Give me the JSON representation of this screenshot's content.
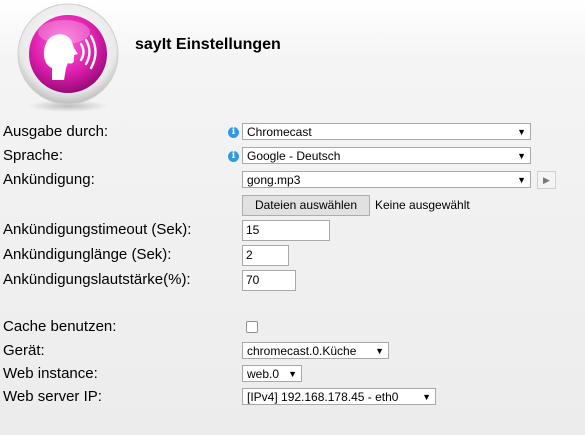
{
  "header": {
    "title": "sayIt Einstellungen",
    "logo_icon": "speaking-head-icon",
    "logo_color": "#e020b0"
  },
  "info_icon_color": "#3399e0",
  "fields": {
    "output": {
      "label": "Ausgabe durch:",
      "value": "Chromecast"
    },
    "language": {
      "label": "Sprache:",
      "value": "Google - Deutsch"
    },
    "announce": {
      "label": "Ankündigung:",
      "value": "gong.mp3",
      "play_icon": "play-icon"
    },
    "file": {
      "button": "Dateien auswählen",
      "status": "Keine ausgewählt"
    },
    "timeout": {
      "label": "Ankündigungstimeout (Sek):",
      "value": "15"
    },
    "length": {
      "label": "Ankündigunglänge (Sek):",
      "value": "2"
    },
    "volume": {
      "label": "Ankündigungslautstärke(%):",
      "value": "70"
    },
    "cache": {
      "label": "Cache benutzen:",
      "checked": false
    },
    "device": {
      "label": "Gerät:",
      "value": "chromecast.0.Küche"
    },
    "web_instance": {
      "label": "Web instance:",
      "value": "web.0"
    },
    "web_server_ip": {
      "label": "Web server IP:",
      "value": "[IPv4] 192.168.178.45 - eth0"
    }
  }
}
